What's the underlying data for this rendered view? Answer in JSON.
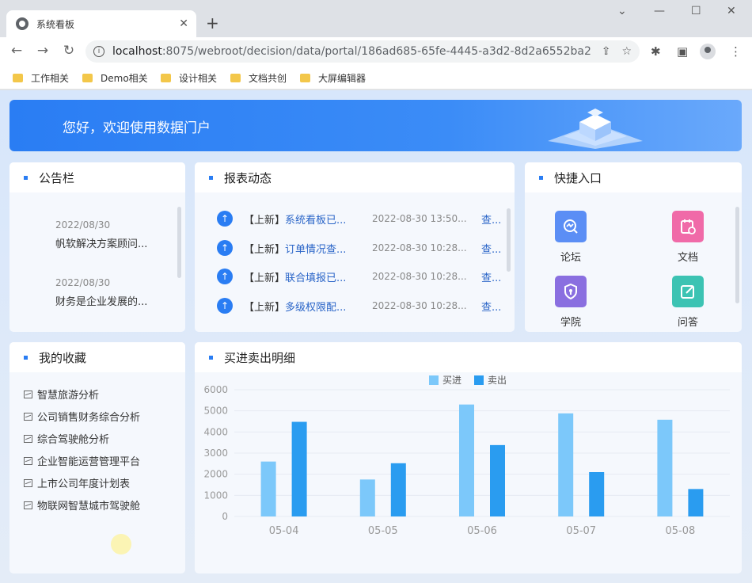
{
  "browser": {
    "tab_title": "系统看板",
    "tab_close": "✕",
    "new_tab": "+",
    "url_host": "localhost",
    "url_rest": ":8075/webroot/decision/data/portal/186ad685-65fe-4445-a3d2-8d2a6552ba2...",
    "bookmarks": [
      "工作相关",
      "Demo相关",
      "设计相关",
      "文档共创",
      "大屏编辑器"
    ]
  },
  "banner": {
    "text": "您好，欢迎使用数据门户"
  },
  "notice_board": {
    "title": "公告栏",
    "items": [
      {
        "date": "2022/08/30",
        "text": "帆软解决方案顾问..."
      },
      {
        "date": "2022/08/30",
        "text": "财务是企业发展的..."
      }
    ]
  },
  "report_feed": {
    "title": "报表动态",
    "view_label": "查...",
    "items": [
      {
        "tag": "【上新】",
        "name": "系统看板已...",
        "time": "2022-08-30 13:50..."
      },
      {
        "tag": "【上新】",
        "name": "订单情况查...",
        "time": "2022-08-30 10:28..."
      },
      {
        "tag": "【上新】",
        "name": "联合填报已...",
        "time": "2022-08-30 10:28..."
      },
      {
        "tag": "【上新】",
        "name": "多级权限配...",
        "time": "2022-08-30 10:28..."
      }
    ]
  },
  "quick_access": {
    "title": "快捷入口",
    "items": [
      {
        "label": "论坛",
        "icon": "forum-icon",
        "color": "#5b8ef5"
      },
      {
        "label": "文档",
        "icon": "calendar-doc-icon",
        "color": "#f06aa8"
      },
      {
        "label": "学院",
        "icon": "shield-icon",
        "color": "#8a6fe0"
      },
      {
        "label": "问答",
        "icon": "edit-icon",
        "color": "#3cc3b3"
      }
    ]
  },
  "favorites": {
    "title": "我的收藏",
    "items": [
      "智慧旅游分析",
      "公司销售财务综合分析",
      "综合驾驶舱分析",
      "企业智能运营管理平台",
      "上市公司年度计划表",
      "物联网智慧城市驾驶舱"
    ]
  },
  "chart_panel": {
    "title": "买进卖出明细"
  },
  "chart_data": {
    "type": "bar",
    "title": "",
    "categories": [
      "05-04",
      "05-05",
      "05-06",
      "05-07",
      "05-08"
    ],
    "series": [
      {
        "name": "买进",
        "values": [
          2600,
          1750,
          5300,
          4880,
          4580
        ],
        "color": "#7cc8fa"
      },
      {
        "name": "卖出",
        "values": [
          4480,
          2520,
          3380,
          2100,
          1300
        ],
        "color": "#2a9cf0"
      }
    ],
    "yticks": [
      0,
      1000,
      2000,
      3000,
      4000,
      5000,
      6000
    ],
    "ylim": [
      0,
      6000
    ],
    "legend": "top-center",
    "grid": true
  }
}
